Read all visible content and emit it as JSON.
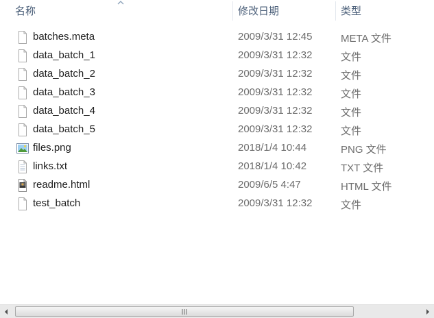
{
  "columns": {
    "name": "名称",
    "date_modified": "修改日期",
    "type": "类型"
  },
  "files": [
    {
      "name": "batches.meta",
      "date": "2009/3/31 12:45",
      "type": "META 文件",
      "icon": "blank-file-icon"
    },
    {
      "name": "data_batch_1",
      "date": "2009/3/31 12:32",
      "type": "文件",
      "icon": "blank-file-icon"
    },
    {
      "name": "data_batch_2",
      "date": "2009/3/31 12:32",
      "type": "文件",
      "icon": "blank-file-icon"
    },
    {
      "name": "data_batch_3",
      "date": "2009/3/31 12:32",
      "type": "文件",
      "icon": "blank-file-icon"
    },
    {
      "name": "data_batch_4",
      "date": "2009/3/31 12:32",
      "type": "文件",
      "icon": "blank-file-icon"
    },
    {
      "name": "data_batch_5",
      "date": "2009/3/31 12:32",
      "type": "文件",
      "icon": "blank-file-icon"
    },
    {
      "name": "files.png",
      "date": "2018/1/4 10:44",
      "type": "PNG 文件",
      "icon": "image-file-icon"
    },
    {
      "name": "links.txt",
      "date": "2018/1/4 10:42",
      "type": "TXT 文件",
      "icon": "text-file-icon"
    },
    {
      "name": "readme.html",
      "date": "2009/6/5 4:47",
      "type": "HTML 文件",
      "icon": "html-file-icon"
    },
    {
      "name": "test_batch",
      "date": "2009/3/31 12:32",
      "type": "文件",
      "icon": "blank-file-icon"
    }
  ],
  "scrollbar": {
    "grip": "III"
  }
}
